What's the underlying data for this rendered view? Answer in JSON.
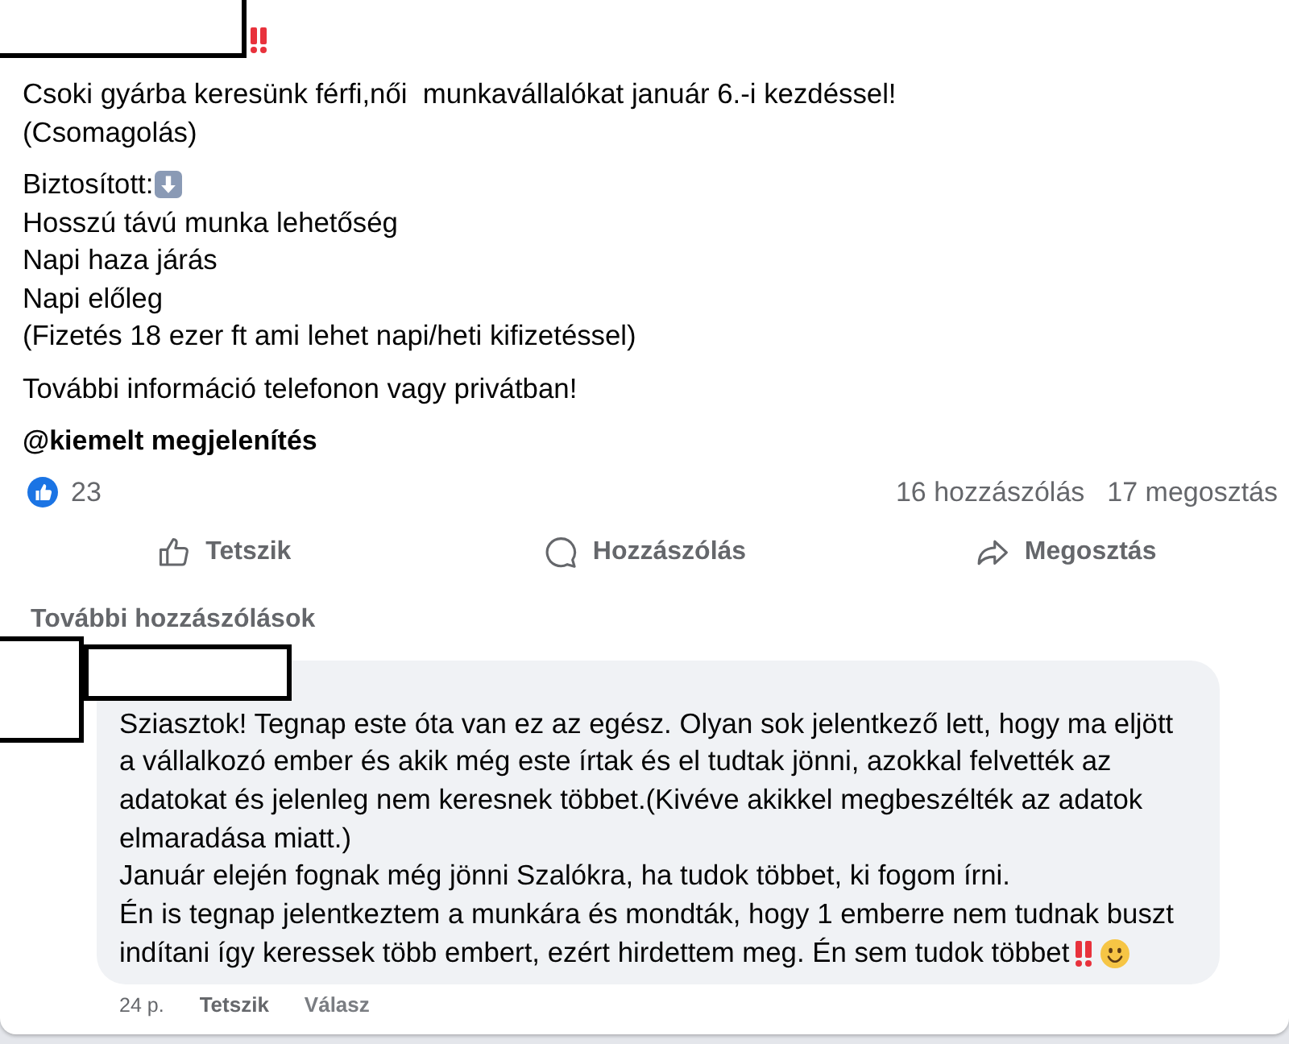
{
  "post": {
    "intro": "Csoki gyárba keresünk férfi,női  munkavállalókat január 6.-i kezdéssel!\n(Csomagolás)",
    "benefits": {
      "label": "Biztosított:",
      "items": [
        "Hosszú távú munka lehetőség",
        "Napi haza járás",
        "Napi előleg",
        "(Fizetés 18 ezer ft ami lehet napi/heti kifizetéssel)"
      ]
    },
    "outro": "További információ telefonon vagy privátban!",
    "tag": "@kiemelt megjelenítés"
  },
  "stats": {
    "reactions": "23",
    "comments": "16 hozzászólás",
    "shares": "17 megosztás"
  },
  "actions": [
    {
      "kind": "like",
      "label": "Tetszik"
    },
    {
      "kind": "comment",
      "label": "Hozzászólás"
    },
    {
      "kind": "share",
      "label": "Megosztás"
    }
  ],
  "more_comments": "További hozzászólások",
  "comments": [
    {
      "lines": [
        "Sziasztok! Tegnap este óta van ez az egész. Olyan sok jelentkező lett, hogy ma eljött",
        "a vállalkozó ember és akik még este írtak és el tudtak jönni, azokkal felvették az",
        "adatokat és jelenleg nem keresnek többet.(Kivéve akikkel megbeszélték az adatok",
        "elmaradása miatt.)",
        "Január elején fognak még jönni Szalókra, ha tudok többet, ki fogom írni.",
        "Én is tegnap jelentkeztem a munkára és mondták, hogy 1 emberre nem tudnak buszt",
        "indítani így keressek több embert, ezért hirdettem meg. Én sem tudok többet"
      ],
      "time": "24 p.",
      "like": "Tetszik",
      "reply": "Válasz"
    }
  ]
}
